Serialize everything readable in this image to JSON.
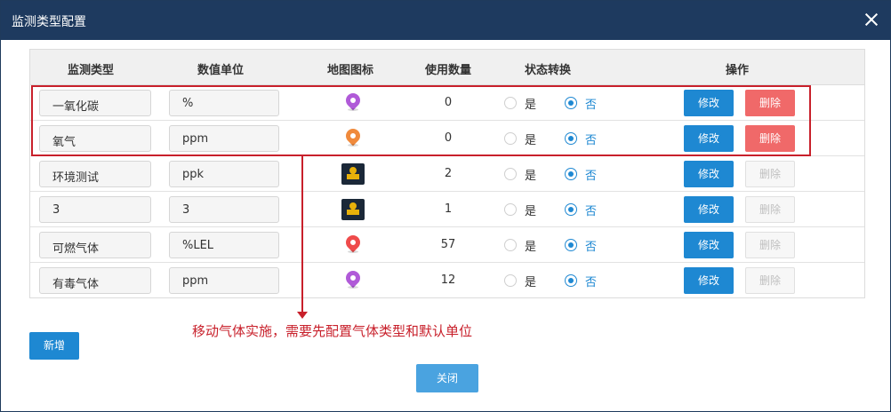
{
  "dialog": {
    "title": "监测类型配置"
  },
  "table": {
    "headers": [
      "监测类型",
      "数值单位",
      "地图图标",
      "使用数量",
      "状态转换",
      "操作"
    ],
    "rows": [
      {
        "type": "一氧化碳",
        "unit": "%",
        "icon": "pin-purple-icon",
        "icon_color": "#b05ad8",
        "count": "0",
        "yes": "是",
        "no": "否",
        "edit": "修改",
        "delete": "删除",
        "delete_enabled": true
      },
      {
        "type": "氧气",
        "unit": "ppm",
        "icon": "pin-orange-icon",
        "icon_color": "#f08a3c",
        "count": "0",
        "yes": "是",
        "no": "否",
        "edit": "修改",
        "delete": "删除",
        "delete_enabled": true
      },
      {
        "type": "环境测试",
        "unit": "ppk",
        "icon": "map-tile-icon",
        "icon_color": "#e8b10a",
        "count": "2",
        "yes": "是",
        "no": "否",
        "edit": "修改",
        "delete": "删除",
        "delete_enabled": false
      },
      {
        "type": "3",
        "unit": "3",
        "icon": "map-tile-icon",
        "icon_color": "#e8b10a",
        "count": "1",
        "yes": "是",
        "no": "否",
        "edit": "修改",
        "delete": "删除",
        "delete_enabled": false
      },
      {
        "type": "可燃气体",
        "unit": "%LEL",
        "icon": "pin-red-icon",
        "icon_color": "#ef4b4b",
        "count": "57",
        "yes": "是",
        "no": "否",
        "edit": "修改",
        "delete": "删除",
        "delete_enabled": false
      },
      {
        "type": "有毒气体",
        "unit": "ppm",
        "icon": "pin-purple-icon",
        "icon_color": "#b05ad8",
        "count": "12",
        "yes": "是",
        "no": "否",
        "edit": "修改",
        "delete": "删除",
        "delete_enabled": false
      }
    ]
  },
  "annotation": {
    "text": "移动气体实施，需要先配置气体类型和默认单位",
    "color": "#c8202b"
  },
  "actions": {
    "add_label": "新增",
    "close_label": "关闭"
  },
  "colors": {
    "titlebar": "#1e3a5f",
    "primary": "#1e88d2",
    "danger": "#f06969"
  }
}
